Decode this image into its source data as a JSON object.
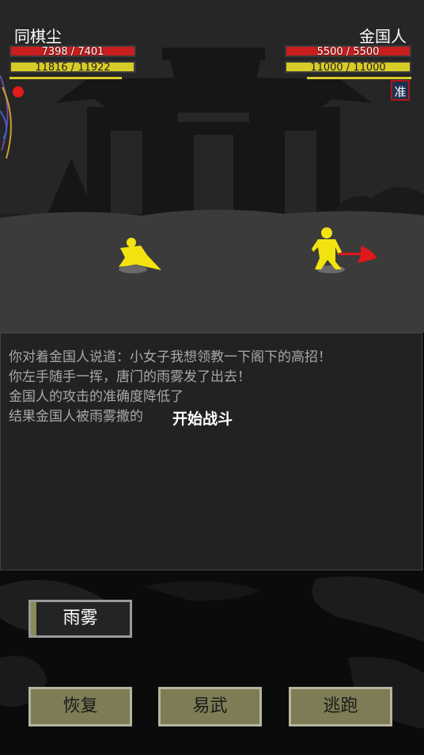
{
  "player": {
    "name": "同棋尘",
    "hp_text": "7398 / 7401",
    "hp_fraction": 0.9996,
    "mp_text": "11816 / 11922",
    "mp_fraction": 0.991
  },
  "enemy": {
    "name": "金国人",
    "hp_text": "5500 / 5500",
    "hp_fraction": 1.0,
    "mp_text": "11000 / 11000",
    "mp_fraction": 1.0,
    "status_badge": "准"
  },
  "battle_log": [
    "你对着金国人说道：小女子我想领教一下阁下的高招！",
    "你左手随手一挥，唐门的雨雾发了出去！",
    "金国人的攻击的准确度降低了",
    "结果金国人被雨雾撒的"
  ],
  "banner": "开始战斗",
  "skill_button": "雨雾",
  "actions": {
    "recover": "恢复",
    "switch_weapon": "易武",
    "flee": "逃跑"
  },
  "colors": {
    "hp": "#c81e1e",
    "mp": "#d8cc28",
    "button_olive": "#7d7c55",
    "highlight_marker": "#e51b1b"
  }
}
